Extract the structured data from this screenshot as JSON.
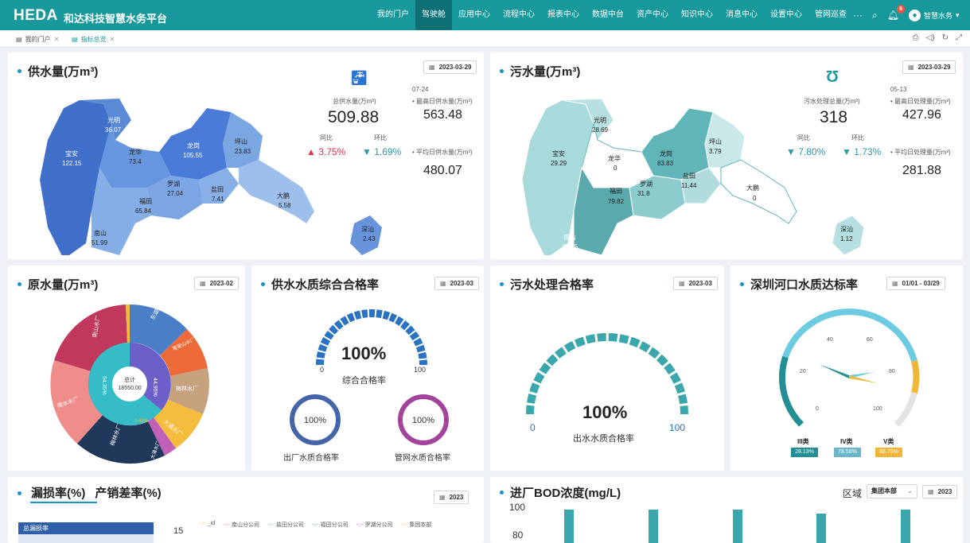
{
  "header": {
    "logo": "HEDA",
    "subtitle": "和达科技智慧水务平台",
    "nav": [
      "我的门户",
      "驾驶舱",
      "应用中心",
      "流程中心",
      "报表中心",
      "数据中台",
      "资产中心",
      "知识中心",
      "消息中心",
      "设置中心",
      "管网巡查"
    ],
    "active_nav": "驾驶舱",
    "more": "···",
    "notification_count": "6",
    "user": "智慧水务"
  },
  "tabs": [
    {
      "label": "我的门户",
      "active": false
    },
    {
      "label": "指标总览",
      "active": true
    }
  ],
  "supply": {
    "title": "供水量(万m³)",
    "date": "2023-03-29",
    "total_label": "总供水量(万m³)",
    "total": "509.88",
    "yoy_label": "同比",
    "yoy": "3.75%",
    "mom_label": "环比",
    "mom": "1.69%",
    "max_date": "07-24",
    "max_label": "最高日供水量(万m³)",
    "max_value": "563.48",
    "avg_label": "平均日供水量(万m³)",
    "avg_value": "480.07",
    "districts": [
      {
        "name": "光明",
        "value": "36.07"
      },
      {
        "name": "宝安",
        "value": "122.15"
      },
      {
        "name": "龙华",
        "value": "73.4"
      },
      {
        "name": "龙岗",
        "value": "105.55"
      },
      {
        "name": "坪山",
        "value": "23.83"
      },
      {
        "name": "罗湖",
        "value": "27.04"
      },
      {
        "name": "盐田",
        "value": "7.41"
      },
      {
        "name": "福田",
        "value": "65.84"
      },
      {
        "name": "南山",
        "value": "51.99"
      },
      {
        "name": "大鹏",
        "value": "5.58"
      },
      {
        "name": "深汕",
        "value": "2.43"
      }
    ]
  },
  "sewage": {
    "title": "污水量(万m³)",
    "date": "2023-03-29",
    "total_label": "污水处理总量(万m³)",
    "total": "318",
    "yoy_label": "同比",
    "yoy": "7.80%",
    "mom_label": "环比",
    "mom": "1.73%",
    "max_date": "05-13",
    "max_label": "最高日处理量(万m³)",
    "max_value": "427.96",
    "avg_label": "平均日处理量(万m³)",
    "avg_value": "281.88",
    "districts": [
      {
        "name": "光明",
        "value": "28.69"
      },
      {
        "name": "宝安",
        "value": "29.29"
      },
      {
        "name": "龙华",
        "value": "0"
      },
      {
        "name": "龙岗",
        "value": "83.83"
      },
      {
        "name": "坪山",
        "value": "3.79"
      },
      {
        "name": "罗湖",
        "value": "31.8"
      },
      {
        "name": "盐田",
        "value": "11.44"
      },
      {
        "name": "福田",
        "value": "79.82"
      },
      {
        "name": "南山",
        "value": "85.45"
      },
      {
        "name": "大鹏",
        "value": "0"
      },
      {
        "name": "深汕",
        "value": "1.12"
      }
    ]
  },
  "raw_water": {
    "title": "原水量(万m³)",
    "date": "2023-02",
    "center_label": "总计",
    "center_value": "18550.00",
    "inner_labels": [
      "44.95%",
      "54.35%",
      "0.43%"
    ],
    "outer_labels": [
      "南山水厂",
      "东湖水厂",
      "笔架山水厂",
      "梅林水厂",
      "大涌水厂",
      "南水水厂",
      "梅林水厂",
      "大涌水厂"
    ]
  },
  "supply_quality": {
    "title": "供水水质综合合格率",
    "date": "2023-03",
    "gauge_value": "100%",
    "gauge_min": "0",
    "gauge_max": "100",
    "gauge_label": "综合合格率",
    "ring1_value": "100%",
    "ring1_label": "出厂水质合格率",
    "ring2_value": "100%",
    "ring2_label": "管网水质合格率"
  },
  "sewage_quality": {
    "title": "污水处理合格率",
    "date": "2023-03",
    "gauge_value": "100%",
    "gauge_min": "0",
    "gauge_max": "100",
    "gauge_label": "出水水质合格率"
  },
  "river": {
    "title": "深圳河口水质达标率",
    "date_range": "01/01 - 03/29",
    "ticks": [
      "0",
      "20",
      "40",
      "60",
      "80",
      "100"
    ],
    "legend": [
      {
        "name": "III类",
        "value": "28.13%"
      },
      {
        "name": "IV类",
        "value": "78.58%"
      },
      {
        "name": "V类",
        "value": "88.75%"
      }
    ]
  },
  "leakage": {
    "tab1": "漏损率(%)",
    "tab2": "产销差率(%)",
    "date": "2023",
    "table_header": "总漏损率",
    "legend": [
      "_id",
      "南山分公司",
      "盐田分公司",
      "福田分公司",
      "罗湖分公司",
      "集团本部"
    ],
    "y_tick": "15"
  },
  "bod": {
    "title": "进厂BOD浓度(mg/L)",
    "region_label": "区域",
    "region_value": "集团本部",
    "date": "2023",
    "y_ticks": [
      "100",
      "80"
    ]
  },
  "colors": {
    "teal": "#17989a",
    "blue_map": "#4a7fd0",
    "teal_map": "#5fb5b8",
    "up": "#e0344f",
    "down": "#2a9aa4"
  }
}
